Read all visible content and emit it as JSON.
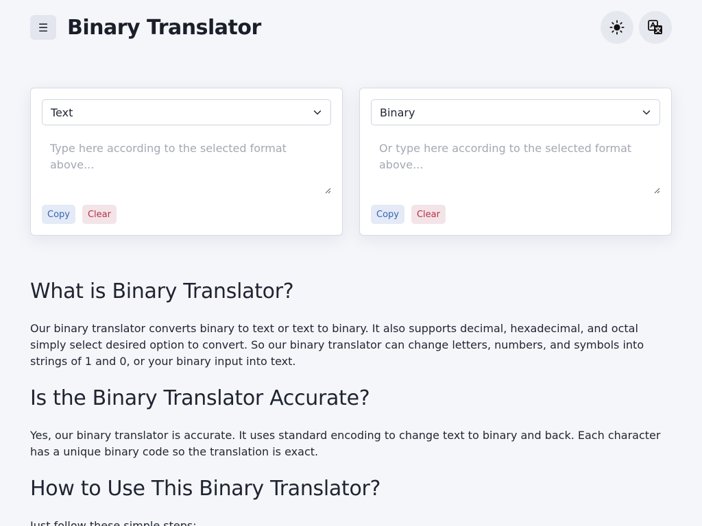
{
  "header": {
    "menu_icon": "menu-icon",
    "title": "Binary Translator",
    "theme_icon": "sun-icon",
    "language_icon": "translate-icon"
  },
  "left_panel": {
    "format": "Text",
    "placeholder": "Type here according to the selected format above...",
    "copy_label": "Copy",
    "clear_label": "Clear"
  },
  "right_panel": {
    "format": "Binary",
    "placeholder": "Or type here according to the selected format above...",
    "copy_label": "Copy",
    "clear_label": "Clear"
  },
  "content": {
    "sections": [
      {
        "heading": "What is Binary Translator?",
        "body": "Our binary translator converts binary to text or text to binary. It also supports decimal, hexadecimal, and octal simply select desired option to convert. So our binary translator can change letters, numbers, and symbols into strings of 1 and 0, or your binary input into text."
      },
      {
        "heading": "Is the Binary Translator Accurate?",
        "body": "Yes, our binary translator is accurate. It uses standard encoding to change text to binary and back. Each character has a unique binary code so the translation is exact."
      },
      {
        "heading": "How to Use This Binary Translator?",
        "body": "Just follow these simple steps:"
      }
    ]
  },
  "colors": {
    "background": "#f5f6fa",
    "copy_text": "#3565b5",
    "clear_text": "#b63146"
  }
}
